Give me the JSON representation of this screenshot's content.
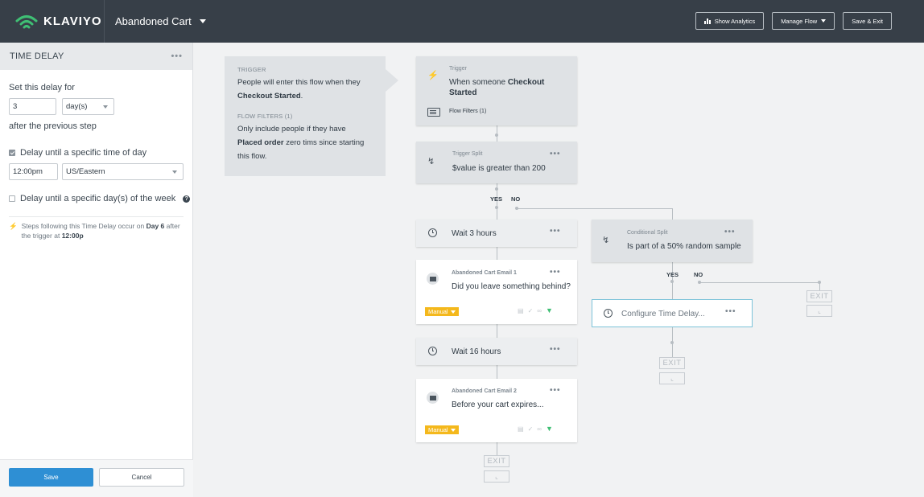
{
  "brand": {
    "name": "KLAVIYO",
    "icon": "wifi-logo-icon",
    "accent": "#3fbf74"
  },
  "flow": {
    "name": "Abandoned Cart"
  },
  "toolbar": {
    "show_analytics": "Show Analytics",
    "manage_flow": "Manage Flow",
    "save_exit": "Save & Exit"
  },
  "panel": {
    "title": "TIME DELAY",
    "menu_dots": "•••",
    "set_delay_label": "Set this delay for",
    "delay_value": "3",
    "delay_unit": "day(s)",
    "after_label": "after the previous step",
    "time_of_day_checkbox": "Delay until a specific time of day",
    "time_of_day_checked": true,
    "time_value": "12:00pm",
    "timezone": "US/Eastern",
    "day_of_week_checkbox": "Delay until a specific day(s) of the week",
    "day_of_week_checked": false,
    "help": "?",
    "note_prefix": "Steps following this Time Delay occur on",
    "note_day": "Day 6",
    "note_middle": "after the trigger at",
    "note_time": "12:00p",
    "save": "Save",
    "cancel": "Cancel",
    "save_color": "#2e8fd4"
  },
  "trigger_info": {
    "trigger_cap": "TRIGGER",
    "trigger_text_1": "People will enter this flow when they",
    "trigger_text_2": "Checkout Started",
    "trigger_text_2_end": ".",
    "filters_cap": "FLOW FILTERS (1)",
    "filters_text_1": "Only include people if they have",
    "filters_text_2_bold": "Placed order",
    "filters_text_2_rest": " zero tims since starting",
    "filters_text_3": "this flow."
  },
  "nodes": {
    "trigger": {
      "cap": "Trigger",
      "text_1": "When someone ",
      "text_bold": "Checkout",
      "text_2": "Started",
      "filters": "Flow Filters (1)"
    },
    "trigger_split": {
      "cap": "Trigger Split",
      "text": "$value is greater than 200",
      "dots": "•••"
    },
    "yes": "YES",
    "no": "NO",
    "wait_3": {
      "text": "Wait 3 hours",
      "dots": "•••"
    },
    "email_1": {
      "cap": "Abandoned Cart Email 1",
      "text": "Did you leave something behind?",
      "dots": "•••",
      "mode": "Manual"
    },
    "wait_16": {
      "text": "Wait 16 hours",
      "dots": "•••"
    },
    "email_2": {
      "cap": "Abandoned Cart Email 2",
      "text": "Before your cart expires...",
      "dots": "•••",
      "mode": "Manual"
    },
    "conditional_split": {
      "cap": "Conditional Split",
      "text": "Is part of a 50% random sample",
      "dots": "•••"
    },
    "configure_delay": {
      "text": "Configure Time Delay...",
      "dots": "•••"
    },
    "exit": "EXIT"
  },
  "colors": {
    "topbar": "#373f48",
    "manual": "#f4b81c",
    "filter_icon": "#3fbf74",
    "selected_border": "#7cc3d9"
  }
}
